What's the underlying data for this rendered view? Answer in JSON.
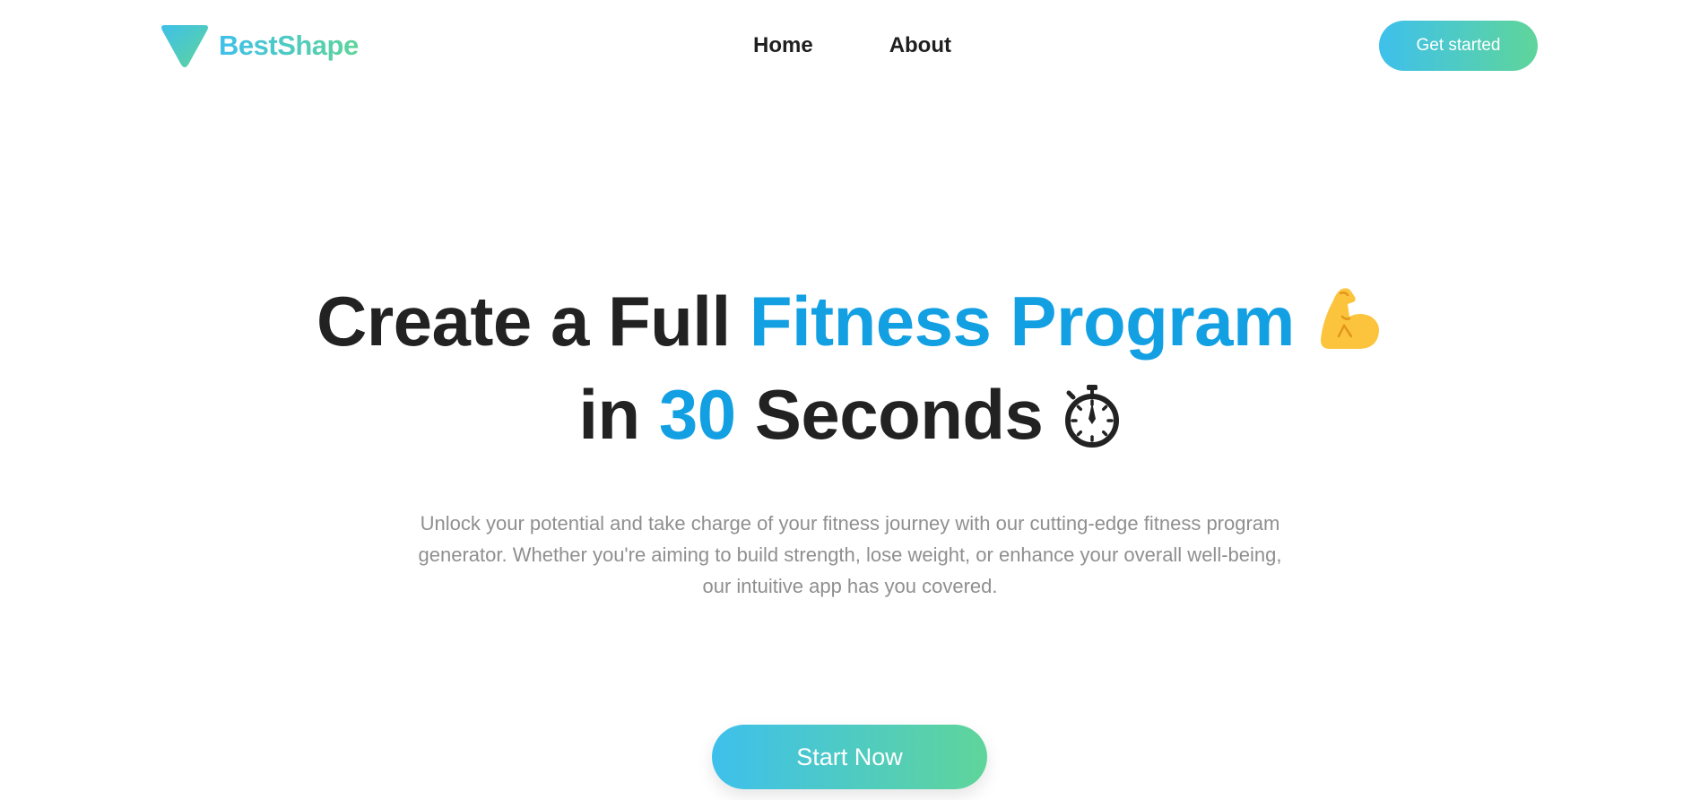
{
  "brand": {
    "name": "BestShape",
    "gradient_start": "#3ec0ea",
    "gradient_end": "#5fd49a"
  },
  "nav": {
    "items": [
      {
        "label": "Home"
      },
      {
        "label": "About"
      }
    ]
  },
  "header": {
    "cta_label": "Get started"
  },
  "hero": {
    "title_part1": "Create a Full ",
    "title_highlight1": "Fitness Program",
    "title_emoji1": "flexed-biceps-icon",
    "title_part2": "in ",
    "title_highlight2": "30",
    "title_part3": " Seconds",
    "title_emoji2": "stopwatch-icon",
    "subtitle": "Unlock your potential and take charge of your fitness journey with our cutting-edge fitness program generator. Whether you're aiming to build strength, lose weight, or enhance your overall well-being, our intuitive app has you covered.",
    "cta_label": "Start Now"
  },
  "colors": {
    "heading": "#222222",
    "highlight": "#12a0e3",
    "subtitle": "#8f8f8f"
  }
}
